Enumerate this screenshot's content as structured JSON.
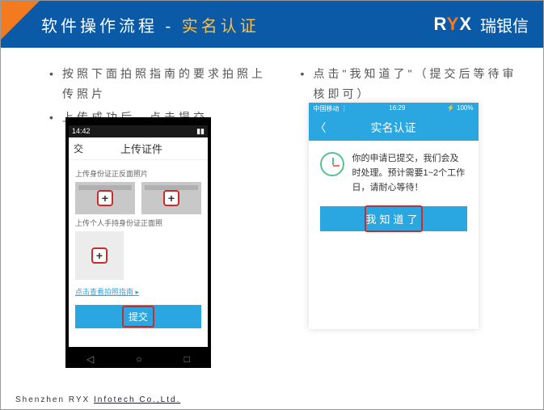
{
  "header": {
    "title_prefix": "软件操作流程 - ",
    "title_accent": "实名认证",
    "brand_logo_r": "R",
    "brand_logo_y": "Y",
    "brand_logo_x": "X",
    "brand_cn": "瑞银信"
  },
  "left": {
    "bullet1": "按照下面拍照指南的要求拍照上传照片",
    "bullet2": "上传成功后，点击提交",
    "statusbar_time": "14:42",
    "nav_back_label": "交",
    "nav_title": "上传证件",
    "sec1_label": "上传身份证正反面照片",
    "sec2_label": "上传个人手持身份证正面照",
    "plus": "+",
    "link_text": "点击查看拍照指南 ▸",
    "submit_label": "提交",
    "soft_back": "◁",
    "soft_home": "○",
    "soft_recent": "□"
  },
  "right": {
    "bullet1": "点击\"我知道了\"（提交后等待审核即可）",
    "carrier": "中国移动",
    "wifi": "⋮",
    "time": "16:29",
    "battery": "100%",
    "back_chev": "〈",
    "nav_title": "实名认证",
    "msg_text": "你的申请已提交，我们会及时处理。预计需要1~2个工作日，请耐心等待！",
    "ok_label": "我知道了"
  },
  "footer": {
    "left": "Shenzhen RYX ",
    "link": "Infotech Co.,Ltd."
  }
}
